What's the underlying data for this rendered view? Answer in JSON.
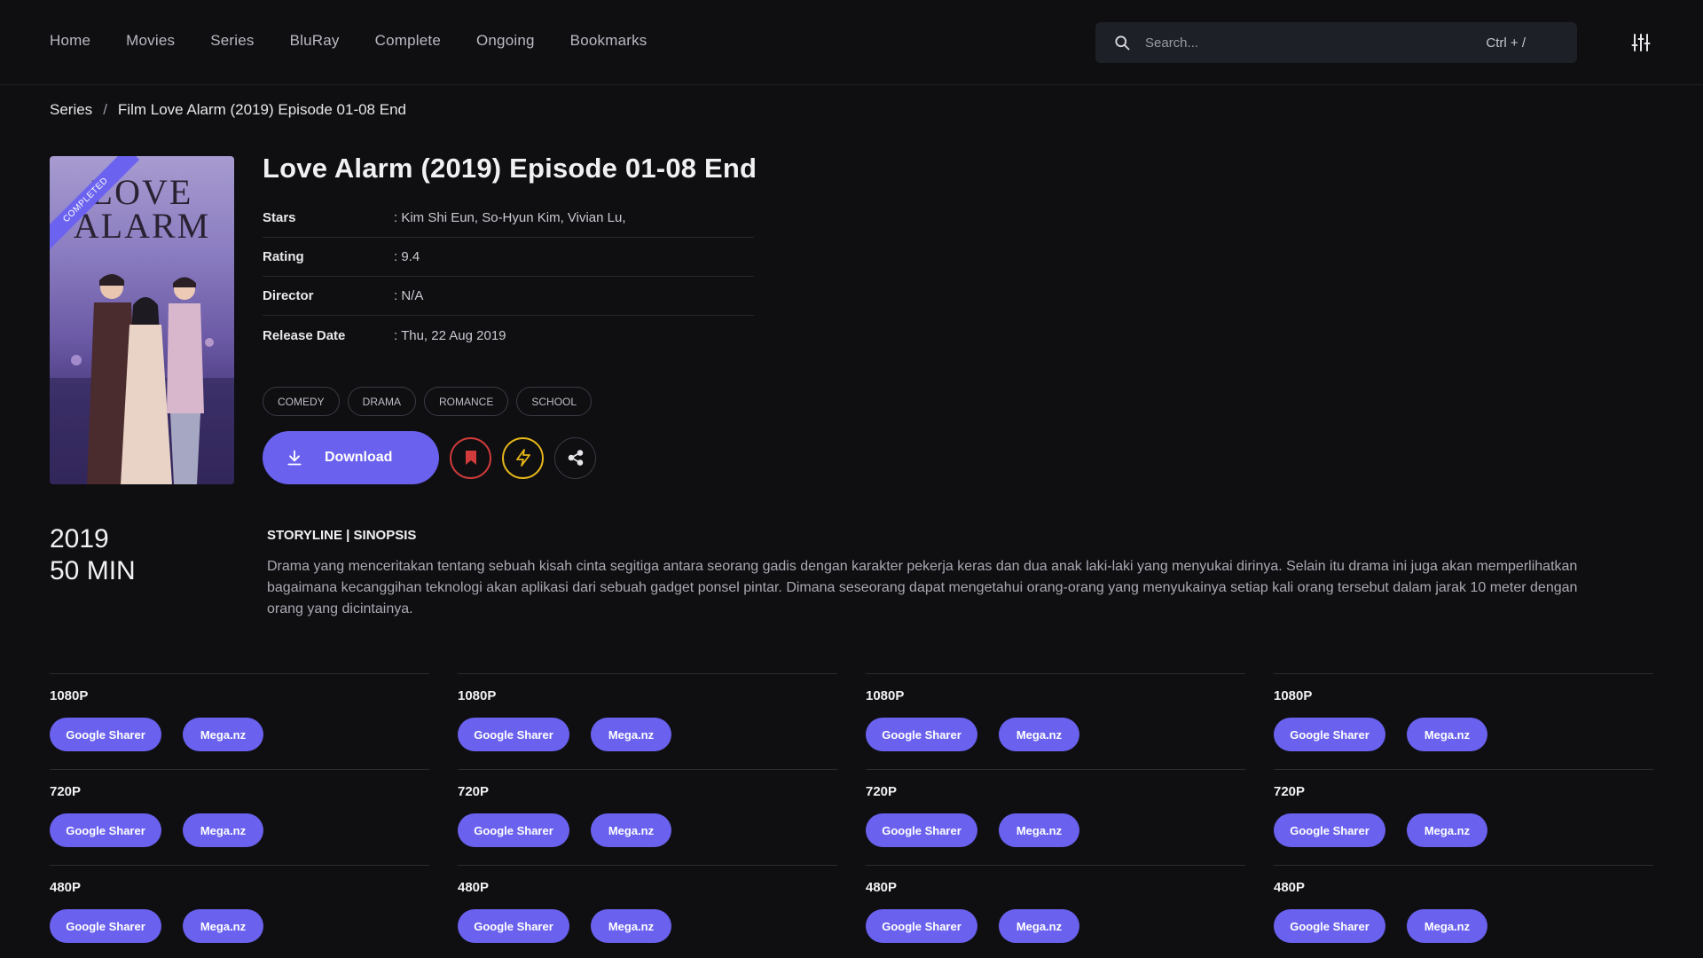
{
  "nav": {
    "items": [
      "Home",
      "Movies",
      "Series",
      "BluRay",
      "Complete",
      "Ongoing",
      "Bookmarks"
    ]
  },
  "search": {
    "placeholder": "Search...",
    "shortcut": "Ctrl + /"
  },
  "breadcrumb": {
    "parent": "Series",
    "separator": "/",
    "current": "Film Love Alarm (2019) Episode 01-08 End"
  },
  "poster": {
    "title": "LOVE ALARM",
    "badge": "COMPLETED"
  },
  "movie": {
    "title": "Love Alarm (2019) Episode 01-08 End",
    "meta": [
      {
        "key": "Stars",
        "value": "Kim Shi Eun, So-Hyun Kim, Vivian Lu,"
      },
      {
        "key": "Rating",
        "value": "9.4"
      },
      {
        "key": "Director",
        "value": "N/A"
      },
      {
        "key": "Release Date",
        "value": "Thu, 22 Aug 2019"
      }
    ],
    "tags": [
      "COMEDY",
      "DRAMA",
      "ROMANCE",
      "SCHOOL"
    ],
    "download_label": "Download",
    "year": "2019",
    "duration": "50 MIN"
  },
  "synopsis": {
    "heading": "STORYLINE | SINOPSIS",
    "text": "Drama yang menceritakan tentang sebuah kisah cinta segitiga antara seorang gadis dengan karakter pekerja keras dan dua anak laki-laki yang menyukai dirinya. Selain itu drama ini juga akan memperlihatkan bagaimana kecanggihan teknologi akan aplikasi dari sebuah gadget ponsel pintar. Dimana seseorang dapat mengetahui orang-orang yang menyukainya setiap kali orang tersebut dalam jarak 10 meter dengan orang yang dicintainya."
  },
  "downloads": {
    "columns": [
      [
        {
          "quality": "1080P",
          "links": [
            "Google Sharer",
            "Mega.nz"
          ]
        },
        {
          "quality": "720P",
          "links": [
            "Google Sharer",
            "Mega.nz"
          ]
        },
        {
          "quality": "480P",
          "links": [
            "Google Sharer",
            "Mega.nz"
          ]
        }
      ],
      [
        {
          "quality": "1080P",
          "links": [
            "Google Sharer",
            "Mega.nz"
          ]
        },
        {
          "quality": "720P",
          "links": [
            "Google Sharer",
            "Mega.nz"
          ]
        },
        {
          "quality": "480P",
          "links": [
            "Google Sharer",
            "Mega.nz"
          ]
        }
      ],
      [
        {
          "quality": "1080P",
          "links": [
            "Google Sharer",
            "Mega.nz"
          ]
        },
        {
          "quality": "720P",
          "links": [
            "Google Sharer",
            "Mega.nz"
          ]
        },
        {
          "quality": "480P",
          "links": [
            "Google Sharer",
            "Mega.nz"
          ]
        }
      ],
      [
        {
          "quality": "1080P",
          "links": [
            "Google Sharer",
            "Mega.nz"
          ]
        },
        {
          "quality": "720P",
          "links": [
            "Google Sharer",
            "Mega.nz"
          ]
        },
        {
          "quality": "480P",
          "links": [
            "Google Sharer",
            "Mega.nz"
          ]
        }
      ]
    ]
  },
  "colors": {
    "accent": "#6a61ee",
    "background": "#0f0f12",
    "bookmark": "#d13b3b",
    "flash": "#e6b619"
  }
}
